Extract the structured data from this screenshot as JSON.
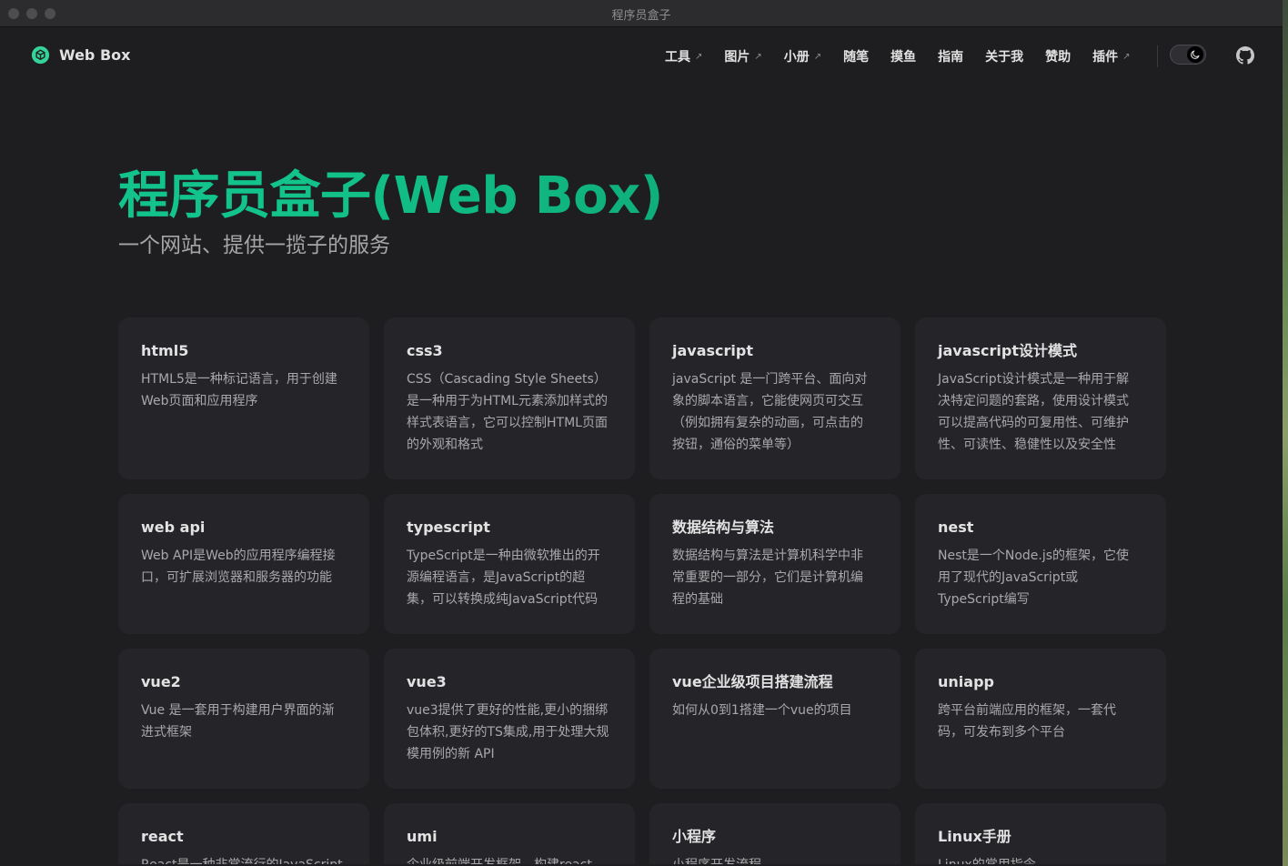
{
  "window": {
    "title": "程序员盒子"
  },
  "nav": {
    "brand": "Web Box",
    "items": [
      {
        "label": "工具",
        "external": true
      },
      {
        "label": "图片",
        "external": true
      },
      {
        "label": "小册",
        "external": true
      },
      {
        "label": "随笔",
        "external": false
      },
      {
        "label": "摸鱼",
        "external": false
      },
      {
        "label": "指南",
        "external": false
      },
      {
        "label": "关于我",
        "external": false
      },
      {
        "label": "赞助",
        "external": false
      },
      {
        "label": "插件",
        "external": true
      }
    ],
    "external_mark": "↗"
  },
  "hero": {
    "title": "程序员盒子(Web Box)",
    "subtitle": "一个网站、提供一揽子的服务"
  },
  "colors": {
    "brand": "#10b981",
    "background": "#1e1e20",
    "card": "#252529"
  },
  "cards": [
    {
      "title": "html5",
      "desc": "HTML5是一种标记语言，用于创建Web页面和应用程序"
    },
    {
      "title": "css3",
      "desc": "CSS（Cascading Style Sheets）是一种用于为HTML元素添加样式的样式表语言，它可以控制HTML页面的外观和格式"
    },
    {
      "title": "javascript",
      "desc": "javaScript 是一门跨平台、面向对象的脚本语言，它能使网页可交互（例如拥有复杂的动画，可点击的按钮，通俗的菜单等）"
    },
    {
      "title": "javascript设计模式",
      "desc": "JavaScript设计模式是一种用于解决特定问题的套路，使用设计模式可以提高代码的可复用性、可维护性、可读性、稳健性以及安全性"
    },
    {
      "title": "web api",
      "desc": "Web API是Web的应用程序编程接口，可扩展浏览器和服务器的功能"
    },
    {
      "title": "typescript",
      "desc": "TypeScript是一种由微软推出的开源编程语言，是JavaScript的超集，可以转换成纯JavaScript代码"
    },
    {
      "title": "数据结构与算法",
      "desc": "数据结构与算法是计算机科学中非常重要的一部分，它们是计算机编程的基础"
    },
    {
      "title": "nest",
      "desc": "Nest是一个Node.js的框架，它使用了现代的JavaScript或TypeScript编写"
    },
    {
      "title": "vue2",
      "desc": "Vue 是一套用于构建用户界面的渐进式框架"
    },
    {
      "title": "vue3",
      "desc": "vue3提供了更好的性能,更小的捆绑包体积,更好的TS集成,用于处理大规模用例的新 API"
    },
    {
      "title": "vue企业级项目搭建流程",
      "desc": "如何从0到1搭建一个vue的项目"
    },
    {
      "title": "uniapp",
      "desc": "跨平台前端应用的框架，一套代码，可发布到多个平台"
    },
    {
      "title": "react",
      "desc": "React是一种非常流行的JavaScript"
    },
    {
      "title": "umi",
      "desc": "企业级前端开发框架，构建react"
    },
    {
      "title": "小程序",
      "desc": "小程序开发流程"
    },
    {
      "title": "Linux手册",
      "desc": "Linux的常用指令"
    }
  ]
}
